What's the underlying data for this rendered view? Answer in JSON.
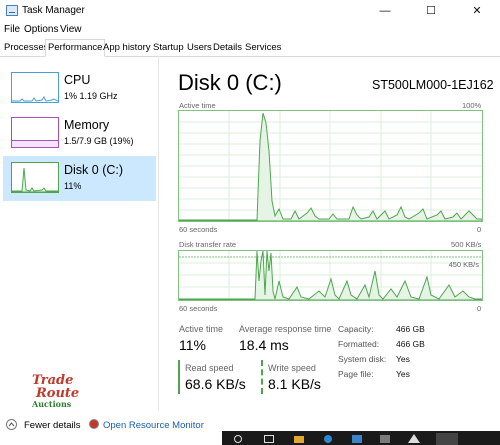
{
  "window": {
    "title": "Task Manager",
    "minimize": "—",
    "maximize": "☐",
    "close": "✕"
  },
  "menu": [
    "File",
    "Options",
    "View"
  ],
  "tabs": [
    {
      "label": "Processes",
      "active": false
    },
    {
      "label": "Performance",
      "active": true
    },
    {
      "label": "App history",
      "active": false
    },
    {
      "label": "Startup",
      "active": false
    },
    {
      "label": "Users",
      "active": false
    },
    {
      "label": "Details",
      "active": false
    },
    {
      "label": "Services",
      "active": false
    }
  ],
  "sidebar": {
    "items": [
      {
        "title": "CPU",
        "subtitle": "1%  1.19 GHz",
        "color": "#4a9fd8"
      },
      {
        "title": "Memory",
        "subtitle": "1.5/7.9 GB (19%)",
        "color": "#a64fbf"
      },
      {
        "title": "Disk 0 (C:)",
        "subtitle": "11%",
        "color": "#4da64d",
        "selected": true
      }
    ]
  },
  "main": {
    "title": "Disk 0 (C:)",
    "model": "ST500LM000-1EJ162",
    "graph1": {
      "label": "Active time",
      "max": "100%",
      "x_left": "60 seconds",
      "x_right": "0"
    },
    "graph2": {
      "label": "Disk transfer rate",
      "max": "500 KB/s",
      "inner": "450 KB/s",
      "x_left": "60 seconds",
      "x_right": "0"
    },
    "stats": {
      "active_time_label": "Active time",
      "active_time": "11%",
      "response_label": "Average response time",
      "response": "18.4 ms",
      "read_label": "Read speed",
      "read": "68.6 KB/s",
      "write_label": "Write speed",
      "write": "8.1 KB/s"
    },
    "props": [
      {
        "label": "Capacity:",
        "value": "466 GB"
      },
      {
        "label": "Formatted:",
        "value": "466 GB"
      },
      {
        "label": "System disk:",
        "value": "Yes"
      },
      {
        "label": "Page file:",
        "value": "Yes"
      }
    ]
  },
  "bottom": {
    "fewer": "Fewer details",
    "monitor": "Open Resource Monitor"
  },
  "watermark": [
    "Trade",
    "Route",
    "Auctions"
  ],
  "colors": {
    "disk_green": "#4da64d",
    "graph_fill": "#e6f4e6",
    "select_bg": "#cce8ff",
    "link": "#1a5fb4"
  },
  "icons": [
    "app-icon",
    "chevron-up-icon",
    "resource-monitor-icon"
  ]
}
